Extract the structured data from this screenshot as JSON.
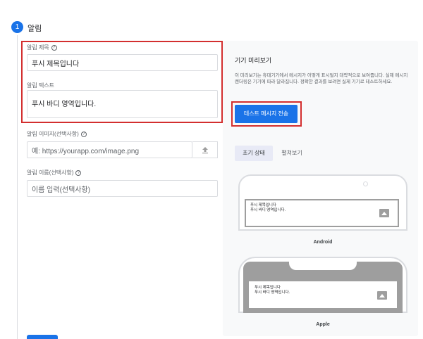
{
  "step": {
    "number": "1",
    "title": "알림"
  },
  "form": {
    "title_label": "알림 제목",
    "title_value": "푸시 제목입니다",
    "text_label": "알림 텍스트",
    "text_value": "푸시 바디 영역입니다.",
    "image_label": "알림 이미지(선택사항)",
    "image_placeholder": "예: https://yourapp.com/image.png",
    "name_label": "알림 이름(선택사항)",
    "name_placeholder": "이름 입력(선택사항)"
  },
  "preview": {
    "title": "기기 미리보기",
    "description": "이 미리보기는 휴대기기에서 메시지가 어떻게 표시될지 대략적으로 보여줍니다. 실제 메시지 렌더링은 기기에 따라 달라집니다. 정확한 결과를 보려면 실제 기기로 테스트하세요.",
    "send_test_label": "테스트 메시지 전송",
    "tabs": [
      "초기 상태",
      "펼쳐보기"
    ],
    "android": {
      "label": "Android",
      "notif_title": "푸시 제목입니다",
      "notif_body": "푸시 바디 영역입니다."
    },
    "apple": {
      "label": "Apple",
      "notif_title": "푸시 제목입니다",
      "notif_body": "푸시 바디 영역입니다."
    }
  },
  "colors": {
    "accent": "#1a73e8",
    "highlight": "#d32f2f"
  }
}
